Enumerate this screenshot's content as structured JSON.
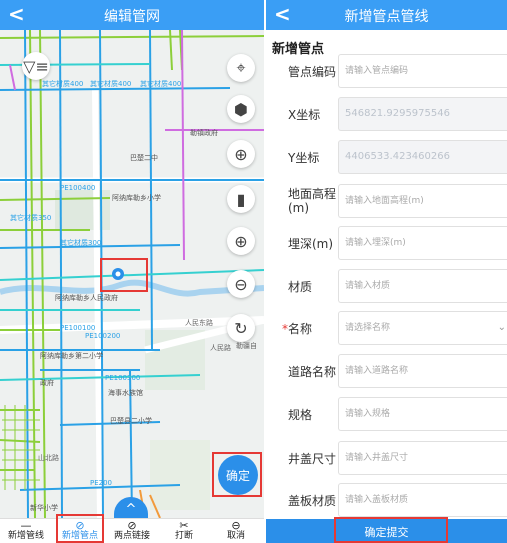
{
  "left_screen": {
    "header": {
      "back_glyph": "<",
      "title": "编辑管网"
    },
    "map_labels": {
      "pipe_400_a": "其它材质400",
      "pipe_400_b": "其它材质400",
      "pipe_400_c": "其它材质400",
      "pipe_300": "其它材质300",
      "pipe_350": "其它材质350",
      "pe400": "PE100400",
      "pe200": "PE100200",
      "pe300": "PE100300",
      "pe100": "PE100100",
      "pe200b": "PE200",
      "poi_1": "勒镇政府",
      "poi_2": "巴楚二中",
      "poi_3": "阿纳库勒乡小学",
      "poi_4": "阿纳库勒乡人民政府",
      "poi_5": "阿纳库勒乡第二小学",
      "poi_6": "政府",
      "poi_7": "海事水族馆",
      "poi_8": "巴楚县二小学",
      "poi_9": "新华小学",
      "road_1": "人民东路",
      "road_2": "人民路",
      "road_3": "山北路",
      "road_4": "勒疆自"
    },
    "map_controls": [
      {
        "icon": "filter-icon",
        "glyph": "▽≡"
      },
      {
        "icon": "location-pin-icon",
        "glyph": "⌖"
      },
      {
        "icon": "layer-icon",
        "glyph": "⬢"
      },
      {
        "icon": "crosshair-icon",
        "glyph": "⊕"
      },
      {
        "icon": "ruler-icon",
        "glyph": "▮"
      },
      {
        "icon": "zoom-in-icon",
        "glyph": "⊕"
      },
      {
        "icon": "zoom-out-icon",
        "glyph": "⊖"
      },
      {
        "icon": "refresh-icon",
        "glyph": "↻"
      }
    ],
    "confirm_label": "确定",
    "up_glyph": "^",
    "toolbar": [
      {
        "icon": "line-icon",
        "glyph": "—",
        "label": "新增管线"
      },
      {
        "icon": "compass-icon",
        "glyph": "⊘",
        "label": "新增管点"
      },
      {
        "icon": "link-icon",
        "glyph": "⊘",
        "label": "两点链接"
      },
      {
        "icon": "scissors-icon",
        "glyph": "✂",
        "label": "打断"
      },
      {
        "icon": "cancel-icon",
        "glyph": "⊖",
        "label": "取消"
      }
    ],
    "colors": {
      "header": "#3a9ef5",
      "accent": "#2b8fe9",
      "highlight": "#e53935"
    }
  },
  "right_screen": {
    "header": {
      "back_glyph": "<",
      "title": "新增管点管线"
    },
    "section_title": "新增管点",
    "fields": [
      {
        "label": "管点编码",
        "value": "",
        "placeholder": "请输入管点编码",
        "disabled": false
      },
      {
        "label": "X坐标",
        "value": "546821.9295975546",
        "placeholder": "",
        "disabled": true
      },
      {
        "label": "Y坐标",
        "value": "4406533.423460266",
        "placeholder": "",
        "disabled": true
      },
      {
        "label": "地面高程(m)",
        "value": "",
        "placeholder": "请输入地面高程(m)",
        "disabled": false
      },
      {
        "label": "埋深(m)",
        "value": "",
        "placeholder": "请输入埋深(m)",
        "disabled": false
      },
      {
        "label": "材质",
        "value": "",
        "placeholder": "请输入材质",
        "disabled": false
      },
      {
        "label": "名称",
        "value": "",
        "placeholder": "请选择名称",
        "disabled": false,
        "required": true
      },
      {
        "label": "道路名称",
        "value": "",
        "placeholder": "请输入道路名称",
        "disabled": false
      },
      {
        "label": "规格",
        "value": "",
        "placeholder": "请输入规格",
        "disabled": false
      },
      {
        "label": "井盖尺寸",
        "value": "",
        "placeholder": "请输入井盖尺寸",
        "disabled": false
      },
      {
        "label": "盖板材质",
        "value": "",
        "placeholder": "请输入盖板材质",
        "disabled": false
      }
    ],
    "required_mark": "*",
    "select_glyph": "⌄",
    "submit_label": "确定提交"
  }
}
